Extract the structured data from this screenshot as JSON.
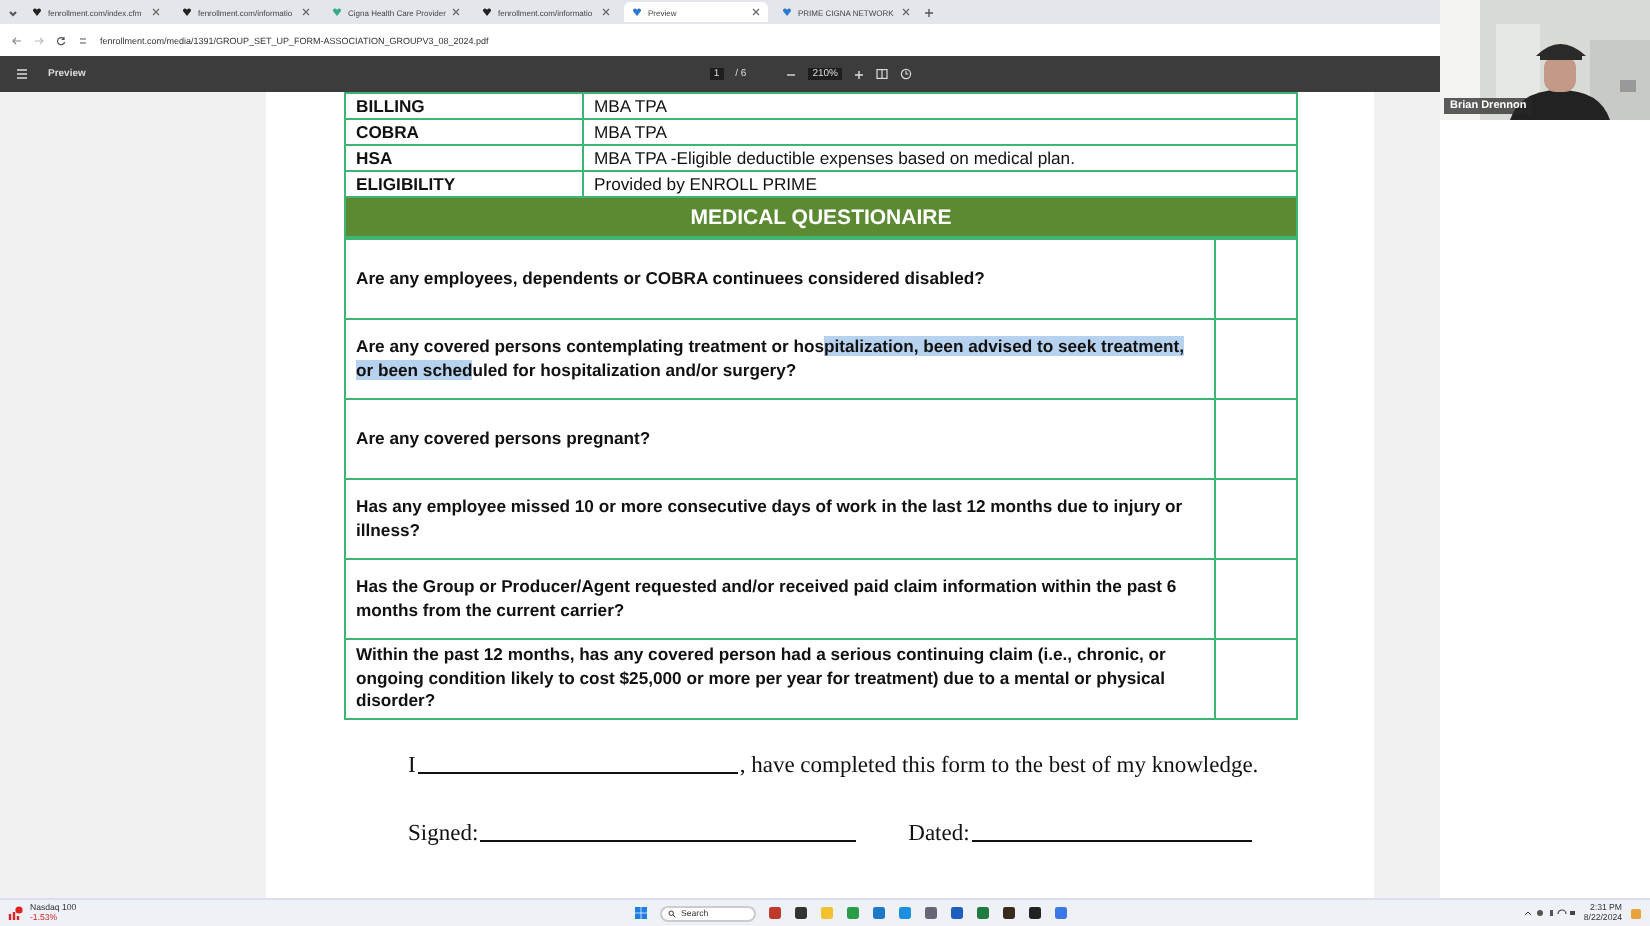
{
  "browser": {
    "tabs": [
      {
        "title": "fenrollment.com/index.cfm",
        "selected": false
      },
      {
        "title": "fenrollment.com/informatio",
        "selected": false
      },
      {
        "title": "Cigna Health Care Provider",
        "selected": false
      },
      {
        "title": "fenrollment.com/informatio",
        "selected": false
      },
      {
        "title": "Preview",
        "selected": true
      },
      {
        "title": "PRIME CIGNA NETWORK",
        "selected": false
      }
    ],
    "address": "fenrollment.com/media/1391/GROUP_SET_UP_FORM-ASSOCIATION_GROUPV3_08_2024.pdf"
  },
  "viewer": {
    "title": "Preview",
    "page": "1",
    "page_count": "/ 6",
    "zoom": "210%"
  },
  "info_rows": [
    {
      "label": "BILLING",
      "value": "MBA TPA"
    },
    {
      "label": "COBRA",
      "value": "MBA TPA"
    },
    {
      "label": "HSA",
      "value": "MBA TPA -Eligible deductible expenses based on medical plan."
    },
    {
      "label": "ELIGIBILITY",
      "value": "Provided by ENROLL PRIME"
    }
  ],
  "section_title": "MEDICAL QUESTIONAIRE",
  "questions": [
    {
      "parts": [
        {
          "text": "Are any employees, dependents or COBRA continuees considered disabled?",
          "highlighted": false
        }
      ]
    },
    {
      "parts": [
        {
          "text": "Are any covered persons contemplating treatment or hos",
          "highlighted": false
        },
        {
          "text": "pitalization, been advised to seek treatment, or been sched",
          "highlighted": true
        },
        {
          "text": "uled for hospitalization and/or surgery?",
          "highlighted": false
        }
      ]
    },
    {
      "parts": [
        {
          "text": "Are any covered persons pregnant?",
          "highlighted": false
        }
      ]
    },
    {
      "parts": [
        {
          "text": "Has any employee missed 10 or more consecutive days of work in the last 12 months due to injury or illness?",
          "highlighted": false
        }
      ]
    },
    {
      "parts": [
        {
          "text": "Has the Group or Producer/Agent requested and/or received paid claim information within the past 6 months from the current carrier?",
          "highlighted": false
        }
      ]
    },
    {
      "parts": [
        {
          "text": "Within the past 12 months, has any covered person had a serious continuing claim (i.e., chronic, or ongoing condition likely to cost $25,000 or more per year for treatment) due to a mental or physical disorder?",
          "highlighted": false
        }
      ]
    }
  ],
  "attestation": {
    "prefix": "I",
    "suffix": ", have completed this form to the best of my knowledge."
  },
  "signature": {
    "signed_label": "Signed:",
    "dated_label": "Dated:"
  },
  "video": {
    "name": "Brian Drennon"
  },
  "taskbar": {
    "widget_title": "Nasdaq 100",
    "widget_value": "-1.53%",
    "search": "Search",
    "time": "2:31 PM",
    "date": "8/22/2024"
  }
}
